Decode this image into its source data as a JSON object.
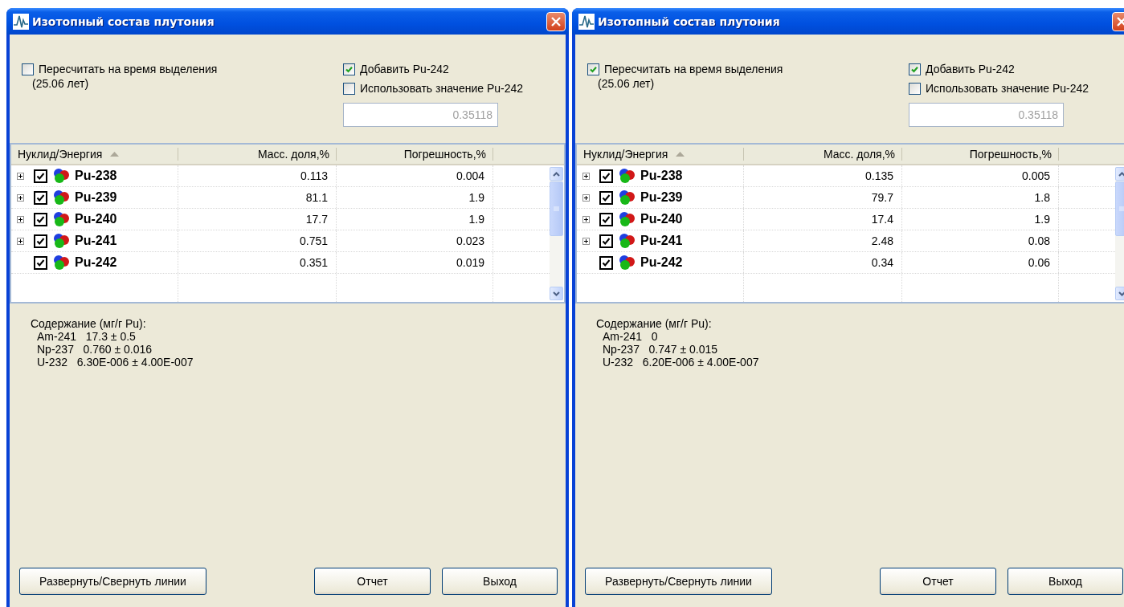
{
  "windows": [
    {
      "title": "Изотопный состав плутония",
      "recalc": {
        "label": "Пересчитать на время выделения",
        "checked": false,
        "note": "(25.06 лет)"
      },
      "add_pu242": {
        "label": "Добавить Pu-242",
        "checked": true
      },
      "use_value": {
        "label": "Использовать значение Pu-242",
        "checked": false
      },
      "value_field": {
        "value": "0.35118",
        "disabled": true
      },
      "table": {
        "columns": [
          {
            "label": "Нуклид/Энергия",
            "sorted": true
          },
          {
            "label": "Масс. доля,%",
            "sorted": false
          },
          {
            "label": "Погрешность,%",
            "sorted": false
          }
        ],
        "rows": [
          {
            "nuclide": "Pu-238",
            "mass": "0.113",
            "error": "0.004",
            "expandable": true,
            "checked": true
          },
          {
            "nuclide": "Pu-239",
            "mass": "81.1",
            "error": "1.9",
            "expandable": true,
            "checked": true
          },
          {
            "nuclide": "Pu-240",
            "mass": "17.7",
            "error": "1.9",
            "expandable": true,
            "checked": true
          },
          {
            "nuclide": "Pu-241",
            "mass": "0.751",
            "error": "0.023",
            "expandable": true,
            "checked": true
          },
          {
            "nuclide": "Pu-242",
            "mass": "0.351",
            "error": "0.019",
            "expandable": false,
            "checked": true
          }
        ]
      },
      "content": {
        "heading": "Содержание (мг/г Pu):",
        "lines": [
          "Am-241   17.3 ± 0.5",
          "Np-237   0.760 ± 0.016",
          "U-232   6.30E-006 ± 4.00E-007"
        ]
      },
      "buttons": [
        "Развернуть/Свернуть линии",
        "Отчет",
        "Выход"
      ]
    },
    {
      "title": "Изотопный состав плутония",
      "recalc": {
        "label": "Пересчитать на время выделения",
        "checked": true,
        "note": "(25.06 лет)"
      },
      "add_pu242": {
        "label": "Добавить Pu-242",
        "checked": true
      },
      "use_value": {
        "label": "Использовать значение Pu-242",
        "checked": false
      },
      "value_field": {
        "value": "0.35118",
        "disabled": true
      },
      "table": {
        "columns": [
          {
            "label": "Нуклид/Энергия",
            "sorted": true
          },
          {
            "label": "Масс. доля,%",
            "sorted": false
          },
          {
            "label": "Погрешность,%",
            "sorted": false
          }
        ],
        "rows": [
          {
            "nuclide": "Pu-238",
            "mass": "0.135",
            "error": "0.005",
            "expandable": true,
            "checked": true
          },
          {
            "nuclide": "Pu-239",
            "mass": "79.7",
            "error": "1.8",
            "expandable": true,
            "checked": true
          },
          {
            "nuclide": "Pu-240",
            "mass": "17.4",
            "error": "1.9",
            "expandable": true,
            "checked": true
          },
          {
            "nuclide": "Pu-241",
            "mass": "2.48",
            "error": "0.08",
            "expandable": true,
            "checked": true
          },
          {
            "nuclide": "Pu-242",
            "mass": "0.34",
            "error": "0.06",
            "expandable": false,
            "checked": true
          }
        ]
      },
      "content": {
        "heading": "Содержание (мг/г Pu):",
        "lines": [
          "Am-241   0",
          "Np-237   0.747 ± 0.015",
          "U-232   6.20E-006 ± 4.00E-007"
        ]
      },
      "buttons": [
        "Развернуть/Свернуть линии",
        "Отчет",
        "Выход"
      ]
    }
  ]
}
